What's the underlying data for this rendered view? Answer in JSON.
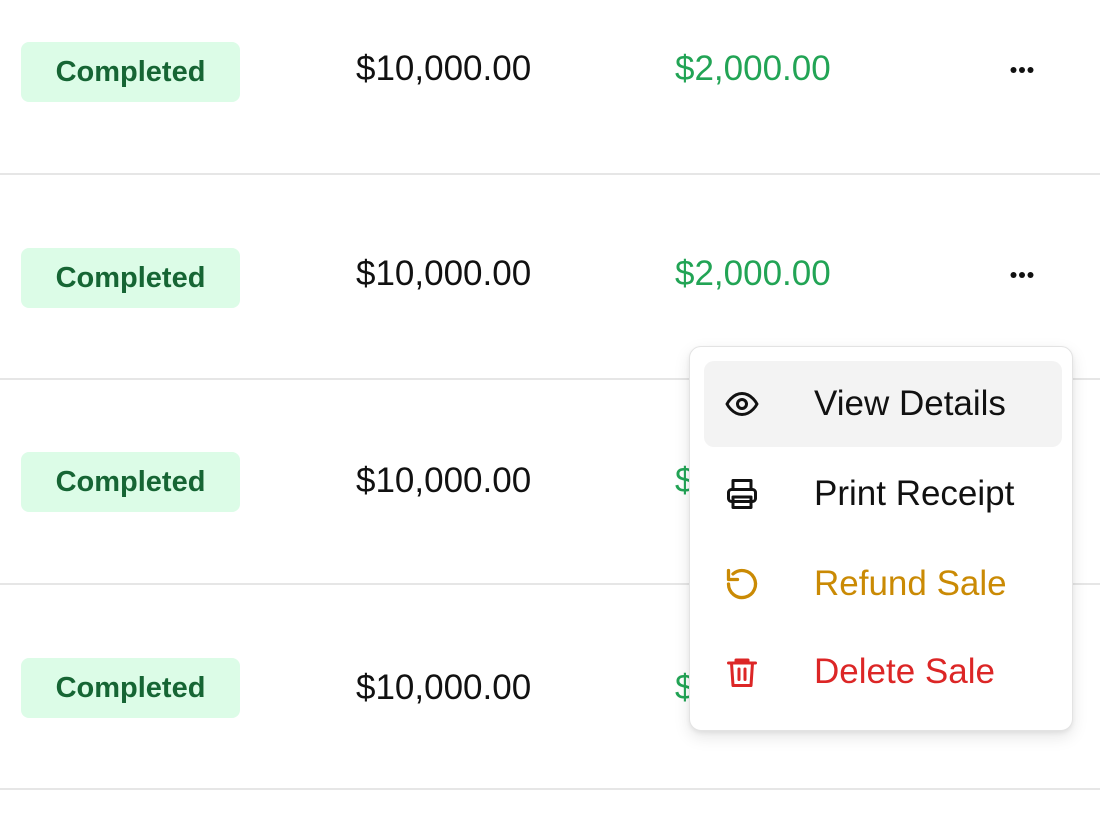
{
  "colors": {
    "badge_bg": "#dcfce7",
    "badge_text": "#166534",
    "paid_amount": "#22a455",
    "refund": "#ca8a04",
    "delete": "#dc2626"
  },
  "rows": [
    {
      "status": "Completed",
      "total": "$10,000.00",
      "paid": "$2,000.00",
      "actions_icon": "more-horizontal-icon"
    },
    {
      "status": "Completed",
      "total": "$10,000.00",
      "paid": "$2,000.00",
      "actions_icon": "more-horizontal-icon"
    },
    {
      "status": "Completed",
      "total": "$10,000.00",
      "paid": "$",
      "actions_icon": "more-horizontal-icon"
    },
    {
      "status": "Completed",
      "total": "$10,000.00",
      "paid": "$",
      "actions_icon": "more-horizontal-icon"
    }
  ],
  "menu": {
    "items": [
      {
        "label": "View Details",
        "icon": "eye-icon"
      },
      {
        "label": "Print Receipt",
        "icon": "printer-icon"
      },
      {
        "label": "Refund Sale",
        "icon": "refund-icon"
      },
      {
        "label": "Delete Sale",
        "icon": "trash-icon"
      }
    ]
  }
}
